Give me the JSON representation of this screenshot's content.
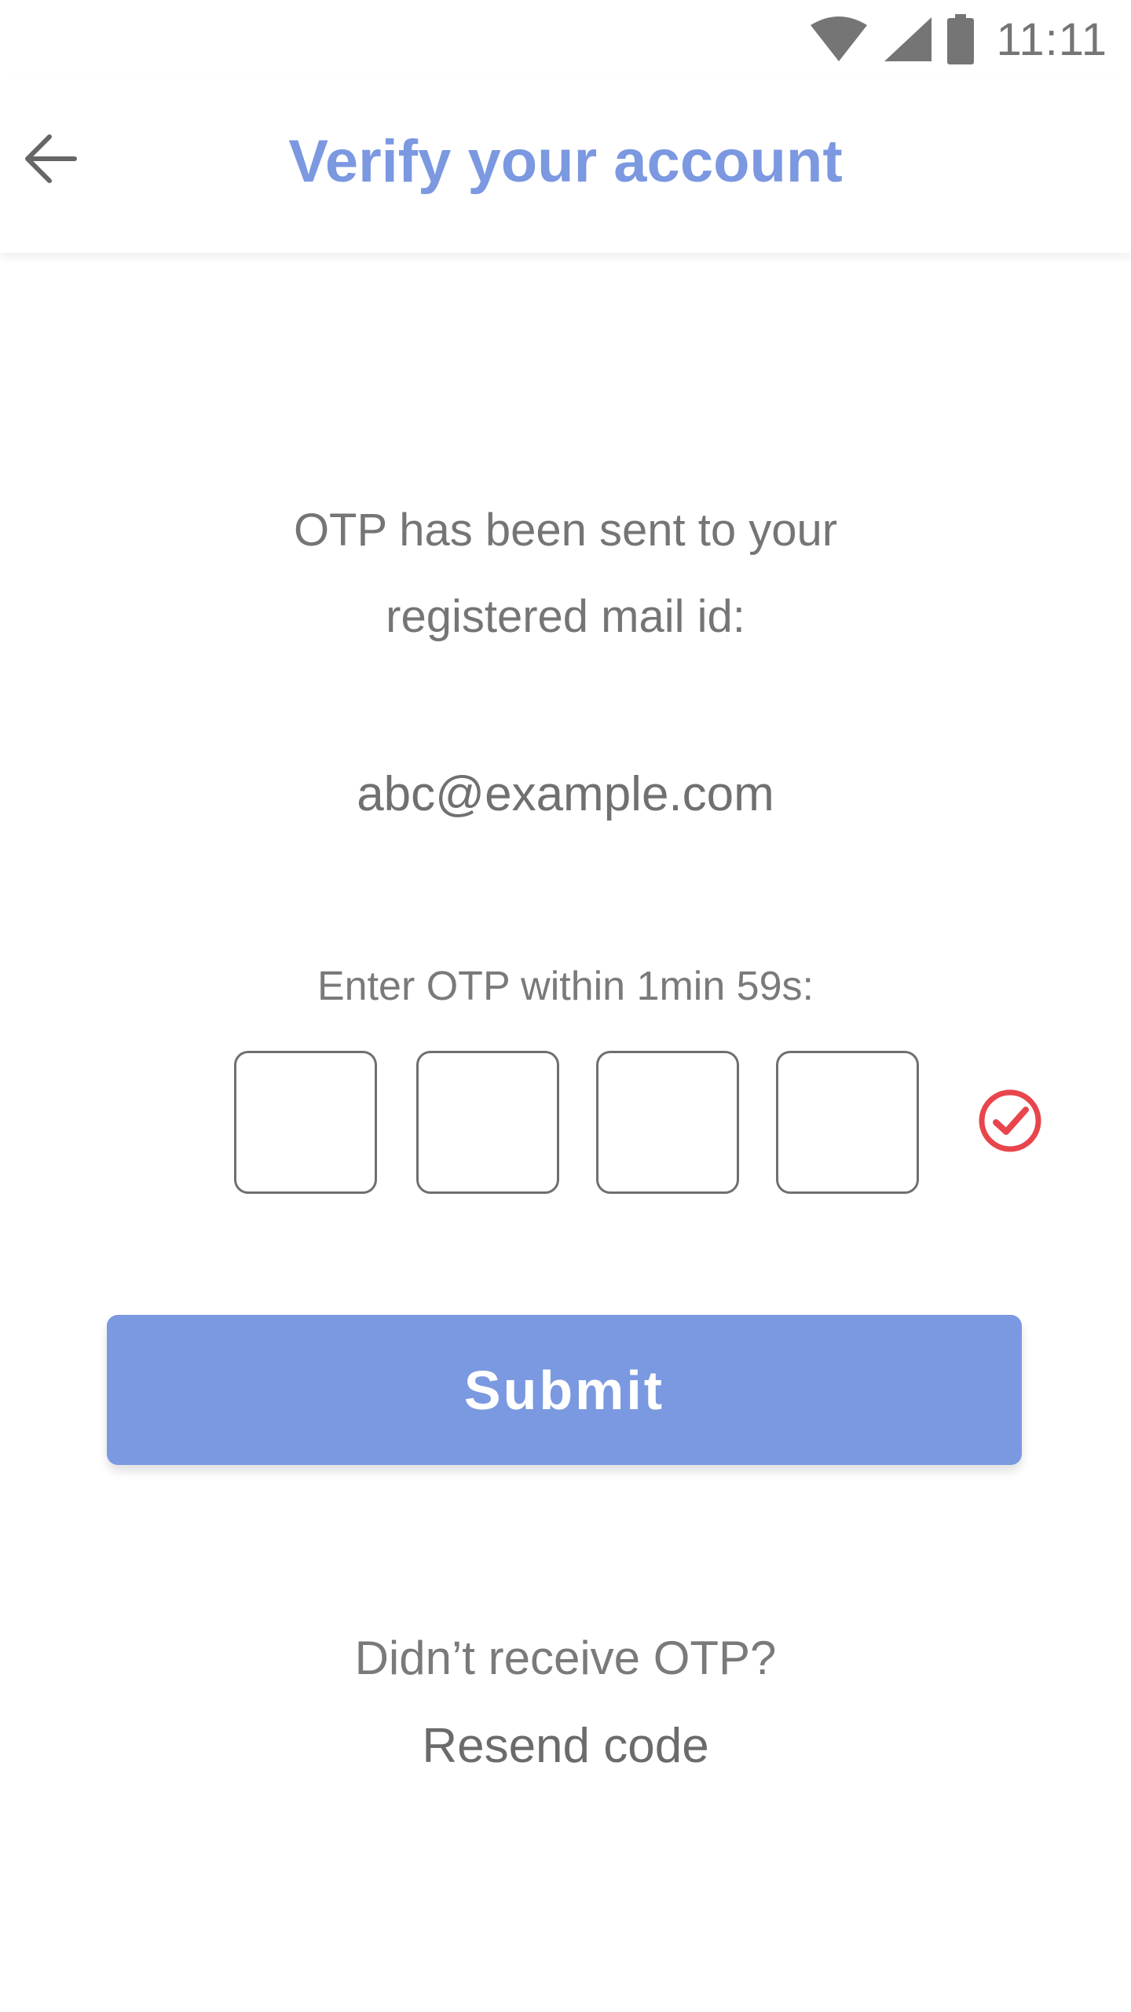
{
  "status_bar": {
    "time": "11:11",
    "icons": [
      "wifi-icon",
      "cell-signal-icon",
      "battery-icon"
    ]
  },
  "app_bar": {
    "title": "Verify your account",
    "back_icon": "arrow-left-icon"
  },
  "message": {
    "line1": "OTP has been sent to your",
    "line2": "registered mail id:"
  },
  "email": "abc@example.com",
  "otp": {
    "label": "Enter OTP within 1min 59s:",
    "digits": [
      "",
      "",
      "",
      ""
    ],
    "status_icon": "check-circle-icon"
  },
  "submit_label": "Submit",
  "resend": {
    "prompt": "Didn’t receive OTP?",
    "link": "Resend code"
  },
  "colors": {
    "accent": "#7b99e0",
    "check": "#e8454c",
    "text": "#757575"
  }
}
